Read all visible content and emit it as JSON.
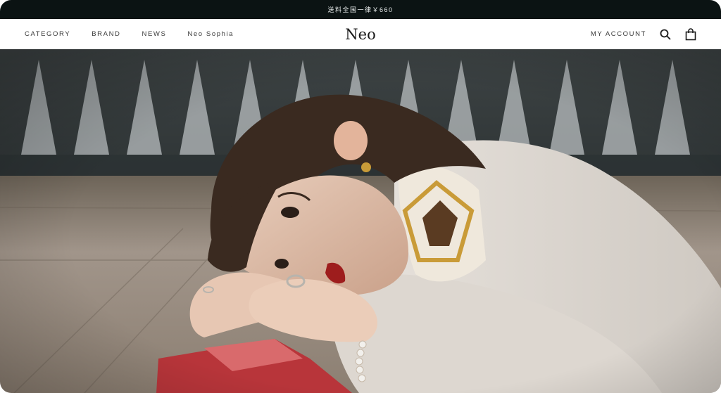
{
  "announcement": {
    "text": "送料全国一律￥660"
  },
  "header": {
    "nav": [
      {
        "label": "CATEGORY"
      },
      {
        "label": "BRAND"
      },
      {
        "label": "NEWS"
      },
      {
        "label": "Neo Sophia"
      }
    ],
    "logo": "Neo",
    "account_label": "MY ACCOUNT",
    "icons": {
      "search": "search-icon",
      "cart": "shopping-bag-icon"
    }
  },
  "hero": {
    "image": "woman-lying-on-wooden-floor-photo"
  }
}
